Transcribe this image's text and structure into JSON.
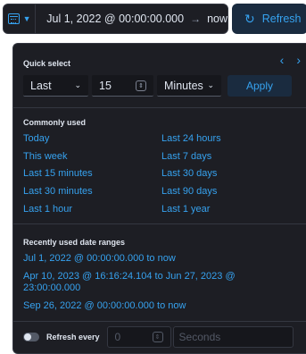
{
  "topbar": {
    "start": "Jul 1, 2022 @ 00:00:00.000",
    "arrow": "→",
    "end": "now",
    "refresh_label": "Refresh"
  },
  "quick_select": {
    "title": "Quick select",
    "tense": "Last",
    "value": "15",
    "unit": "Minutes",
    "apply_label": "Apply"
  },
  "commonly_used": {
    "title": "Commonly used",
    "items": [
      "Today",
      "Last 24 hours",
      "This week",
      "Last 7 days",
      "Last 15 minutes",
      "Last 30 days",
      "Last 30 minutes",
      "Last 90 days",
      "Last 1 hour",
      "Last 1 year"
    ]
  },
  "recent": {
    "title": "Recently used date ranges",
    "items": [
      "Jul 1, 2022 @ 00:00:00.000 to now",
      "Apr 10, 2023 @ 16:16:24.104 to Jun 27, 2023 @ 23:00:00.000",
      "Sep 26, 2022 @ 00:00:00.000 to now"
    ]
  },
  "refresh_every": {
    "label": "Refresh every",
    "value": "0",
    "unit_placeholder": "Seconds"
  }
}
